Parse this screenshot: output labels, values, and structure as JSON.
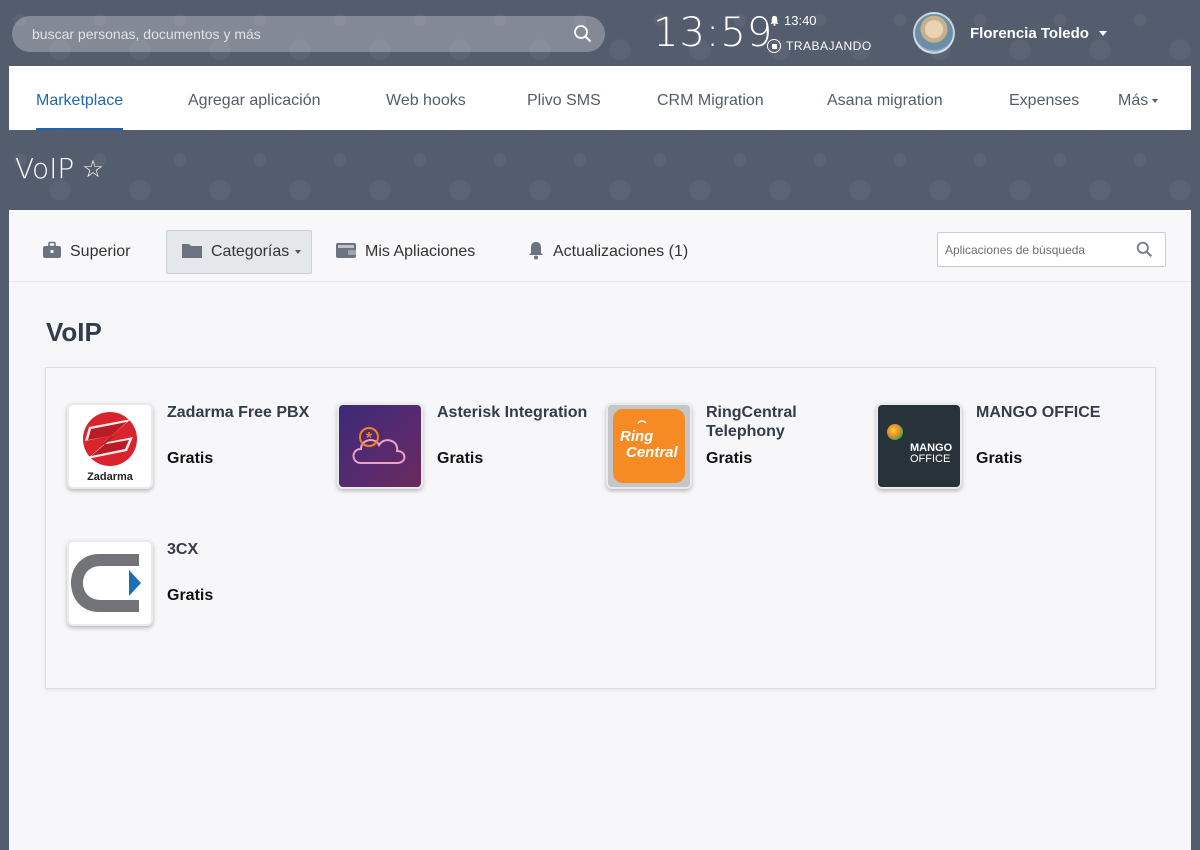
{
  "header": {
    "search_placeholder": "buscar personas, documentos y más",
    "time": "13:59",
    "alarm_time": "13:40",
    "work_status": "TRABAJANDO",
    "user_name": "Florencia Toledo"
  },
  "tabs": [
    {
      "label": "Marketplace",
      "active": true
    },
    {
      "label": "Agregar aplicación"
    },
    {
      "label": "Web hooks"
    },
    {
      "label": "Plivo SMS"
    },
    {
      "label": "CRM Migration"
    },
    {
      "label": "Asana migration"
    },
    {
      "label": "Expenses"
    },
    {
      "label": "Más"
    }
  ],
  "page": {
    "title": "VoIP",
    "star_icon": "☆"
  },
  "toolbar": {
    "items": [
      {
        "label": "Superior",
        "icon": "briefcase-icon"
      },
      {
        "label": "Categorías",
        "icon": "folder-icon",
        "selected": true
      },
      {
        "label": "Mis Apliaciones",
        "icon": "wallet-icon"
      },
      {
        "label": "Actualizaciones (1)",
        "icon": "bell-icon"
      }
    ],
    "search_placeholder": "Aplicaciones de búsqueda"
  },
  "section": {
    "title": "VoIP"
  },
  "apps": [
    {
      "name": "Zadarma Free PBX",
      "price": "Gratis",
      "logo_text": "Zadarma",
      "logo": "zadarma-logo"
    },
    {
      "name": "Asterisk Integration",
      "price": "Gratis",
      "logo": "asterisk-logo"
    },
    {
      "name": "RingCentral Telephony",
      "price": "Gratis",
      "logo_text_1": "Ring",
      "logo_text_2": "Central",
      "logo": "ringcentral-logo"
    },
    {
      "name": "MANGO OFFICE",
      "price": "Gratis",
      "logo_text_1": "MANGO",
      "logo_text_2": "OFFICE",
      "logo": "mango-logo"
    },
    {
      "name": "3CX",
      "price": "Gratis",
      "logo": "3cx-logo"
    }
  ],
  "colors": {
    "accent": "#2067b0",
    "background": "#545d6e",
    "ringcentral_orange": "#f68b24",
    "asterisk_purple": "#4a2a7a",
    "zadarma_red": "#d9232d",
    "mango_dark": "#27323a",
    "cx_blue": "#1b6fb5"
  }
}
